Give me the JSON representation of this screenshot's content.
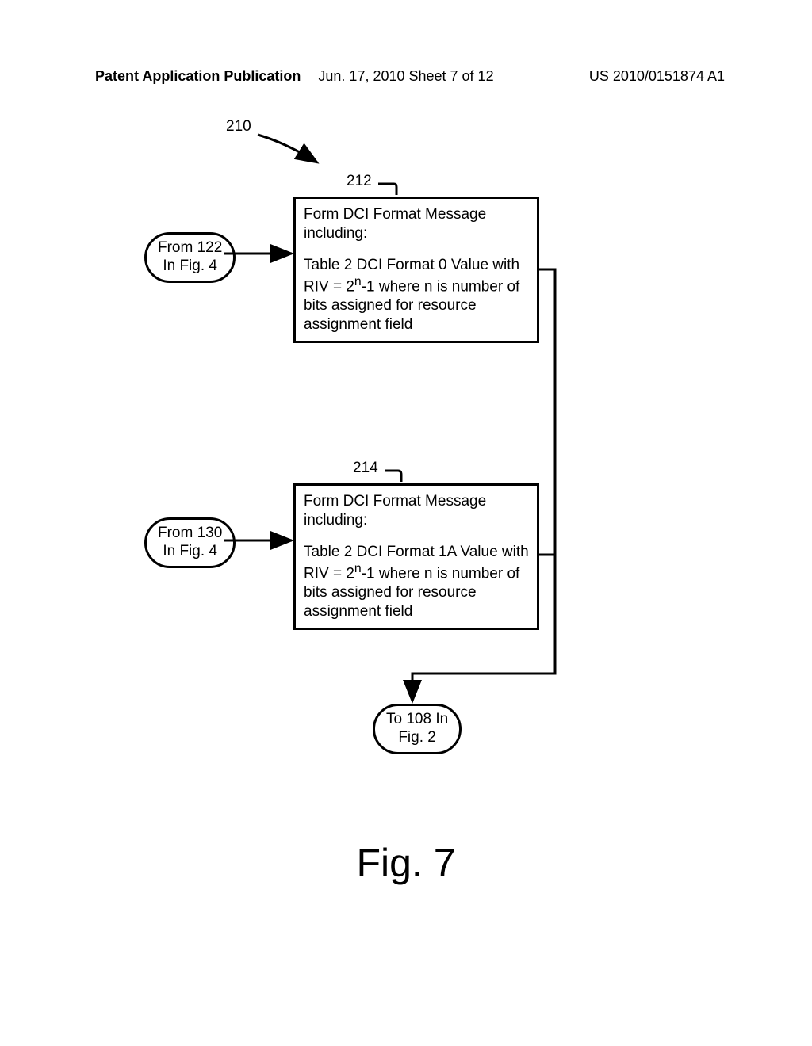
{
  "header": {
    "left": "Patent Application Publication",
    "center": "Jun. 17, 2010  Sheet 7 of 12",
    "right": "US 2010/0151874 A1"
  },
  "labels": {
    "l210": "210",
    "l212": "212",
    "l214": "214"
  },
  "terminals": {
    "t_from122_l1": "From 122",
    "t_from122_l2": "In Fig. 4",
    "t_from130_l1": "From 130",
    "t_from130_l2": "In Fig. 4",
    "t_to108_l1": "To 108 In",
    "t_to108_l2": "Fig. 2"
  },
  "boxes": {
    "b212": {
      "title": "Form DCI Format Message including:",
      "body_pre": "Table 2 DCI Format 0 Value with RIV = 2",
      "body_sup": "n",
      "body_post": "-1 where n is number of bits assigned for resource assignment field"
    },
    "b214": {
      "title": "Form DCI Format Message including:",
      "body_pre": "Table 2 DCI Format 1A Value with RIV = 2",
      "body_sup": "n",
      "body_post": "-1 where n is number of bits assigned for resource assignment field"
    }
  },
  "figure": "Fig. 7"
}
